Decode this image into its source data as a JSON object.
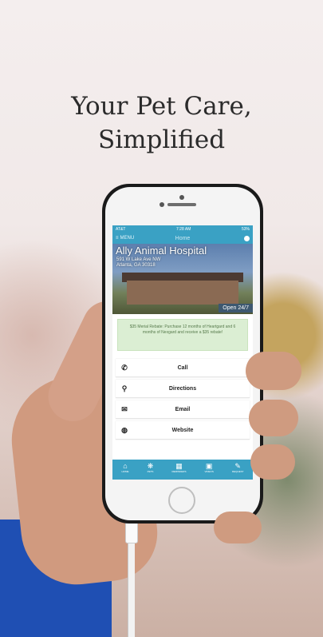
{
  "headline": {
    "line1": "Your Pet Care,",
    "line2": "Simplified"
  },
  "status_bar": {
    "carrier": "AT&T",
    "time": "7:28 AM",
    "battery": "53%"
  },
  "nav": {
    "menu_label": "MENU",
    "title": "Home"
  },
  "hero": {
    "name": "Ally Animal Hospital",
    "address_line1": "591 W Lake Ave NW",
    "address_line2": "Atlanta, GA 30318",
    "hours_badge": "Open 24/7"
  },
  "promo": {
    "text": "$35 Merial Rebate: Purchase 12 months of Heartgard and 6 months of Nexgard and receive a $35 rebate!"
  },
  "actions": [
    {
      "label": "Call",
      "icon": "phone-icon"
    },
    {
      "label": "Directions",
      "icon": "map-pin-icon"
    },
    {
      "label": "Email",
      "icon": "envelope-icon"
    },
    {
      "label": "Website",
      "icon": "globe-icon"
    }
  ],
  "tabs": [
    {
      "label": "HOME",
      "icon": "home-icon"
    },
    {
      "label": "PETS",
      "icon": "paw-icon"
    },
    {
      "label": "REMINDERS",
      "icon": "calendar-icon"
    },
    {
      "label": "VIDEOS",
      "icon": "video-icon"
    },
    {
      "label": "REQUEST",
      "icon": "pencil-icon"
    }
  ],
  "colors": {
    "app_blue": "#3aa1c4",
    "promo_green": "#dbeed3",
    "sleeve_blue": "#1f4fb3"
  }
}
